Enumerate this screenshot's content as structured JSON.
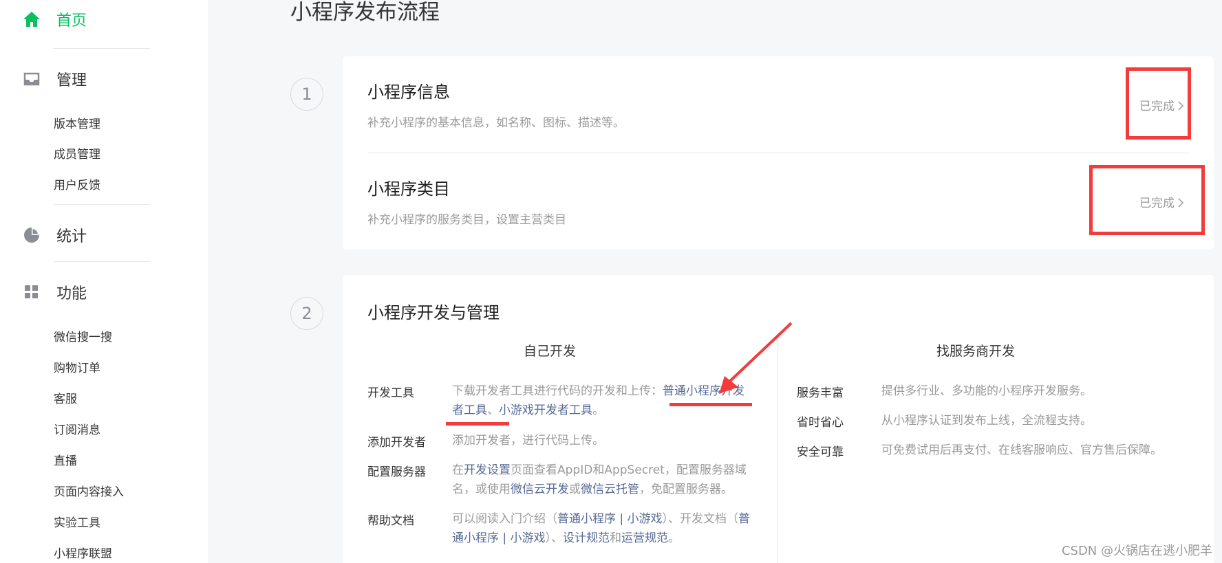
{
  "sidebar": {
    "home": "首页",
    "manage": "管理",
    "manage_items": [
      "版本管理",
      "成员管理",
      "用户反馈"
    ],
    "stats": "统计",
    "features": "功能",
    "feature_items": [
      "微信搜一搜",
      "购物订单",
      "客服",
      "订阅消息",
      "直播",
      "页面内容接入",
      "实验工具",
      "小程序联盟"
    ],
    "accent_color": "#07c160"
  },
  "main": {
    "page_title": "小程序发布流程",
    "step1": {
      "num": "1",
      "info_title": "小程序信息",
      "info_desc": "补充小程序的基本信息，如名称、图标、描述等。",
      "info_status": "已完成",
      "category_title": "小程序类目",
      "category_desc": "补充小程序的服务类目，设置主营类目",
      "category_status": "已完成"
    },
    "step2": {
      "num": "2",
      "title": "小程序开发与管理",
      "self_dev": {
        "heading": "自己开发",
        "dev_tools_label": "开发工具",
        "dev_tools_text": "下载开发者工具进行代码的开发和上传：",
        "dev_tools_link1": "普通小程序开发者工具",
        "dev_tools_sep": "、",
        "dev_tools_link2": "小游戏开发者工具",
        "dev_tools_end": "。",
        "add_dev_label": "添加开发者",
        "add_dev_text": "添加开发者，进行代码上传。",
        "server_label": "配置服务器",
        "server_t1": "在",
        "server_link1": "开发设置",
        "server_t2": "页面查看AppID和AppSecret，配置服务器域名，或使用",
        "server_link2": "微信云开发",
        "server_t3": "或",
        "server_link3": "微信云托管",
        "server_t4": "，免配置服务器。",
        "help_label": "帮助文档",
        "help_t1": "可以阅读入门介绍（",
        "help_link1": "普通小程序",
        "help_sep1": " | ",
        "help_link2": "小游戏",
        "help_t2": "）、开发文档（",
        "help_link3": "普通小程序",
        "help_sep2": " | ",
        "help_link4": "小游戏",
        "help_t3": "）、",
        "help_link5": "设计规范",
        "help_t4": "和",
        "help_link6": "运营规范",
        "help_t5": "。"
      },
      "vendor_dev": {
        "heading": "找服务商开发",
        "rows": [
          {
            "label": "服务丰富",
            "text": "提供多行业、多功能的小程序开发服务。"
          },
          {
            "label": "省时省心",
            "text": "从小程序认证到发布上线，全流程支持。"
          },
          {
            "label": "安全可靠",
            "text": "可免费试用后再支付、在线客服响应、官方售后保障。"
          }
        ]
      }
    }
  },
  "watermark": "CSDN @火锅店在逃小肥羊"
}
